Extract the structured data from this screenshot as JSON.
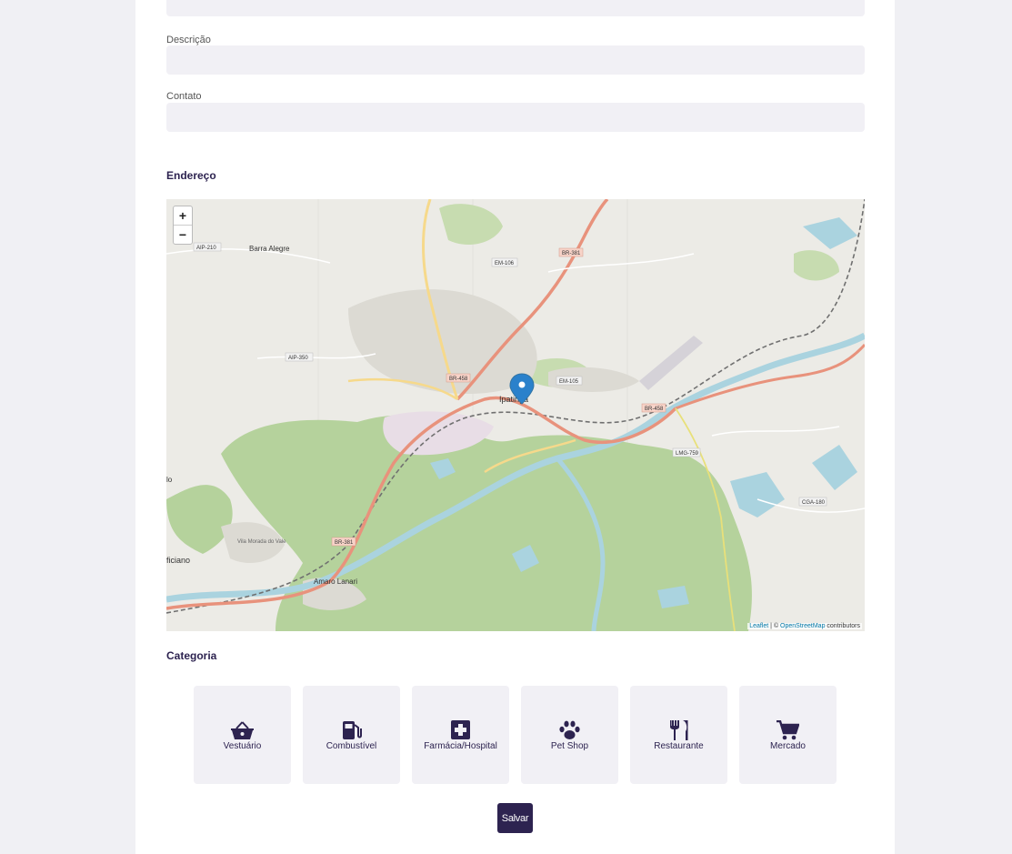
{
  "form": {
    "descricao_label": "Descrição",
    "descricao_value": "",
    "contato_label": "Contato",
    "contato_value": ""
  },
  "endereco": {
    "title": "Endereço",
    "map": {
      "zoom_in": "+",
      "zoom_out": "−",
      "attribution_leaflet": "Leaflet",
      "attribution_sep": " | © ",
      "attribution_osm": "OpenStreetMap",
      "attribution_suffix": " contributors",
      "places": {
        "ipatinga": "Ipatinga",
        "barra_alegre": "Barra Alegre",
        "amaro_lanari": "Amaro Lanari",
        "timoteo_frag": "ficiano",
        "lo_frag": "lo",
        "vila_morada": "Vila Morada\ndo Vale"
      },
      "roads": {
        "aip210": "AIP-210",
        "aip350": "AIP-350",
        "em106": "EM-106",
        "em105": "EM-105",
        "br381_top": "BR-381",
        "br458_left": "BR-458",
        "br458_right": "BR-458",
        "br381_bottom": "BR-381",
        "lmg759": "LMG-759",
        "cga180": "CGA-180"
      }
    }
  },
  "categoria": {
    "title": "Categoria",
    "items": [
      {
        "label": "Vestuário",
        "icon": "basket-icon"
      },
      {
        "label": "Combustível",
        "icon": "gas-pump-icon"
      },
      {
        "label": "Farmácia/Hospital",
        "icon": "medical-cross-icon"
      },
      {
        "label": "Pet Shop",
        "icon": "paw-icon"
      },
      {
        "label": "Restaurante",
        "icon": "utensils-icon"
      },
      {
        "label": "Mercado",
        "icon": "cart-icon"
      }
    ]
  },
  "actions": {
    "save_label": "Salvar"
  },
  "colors": {
    "primary": "#2d2350",
    "field_bg": "#f1f0f5",
    "page_bg": "#f0f0f4"
  }
}
